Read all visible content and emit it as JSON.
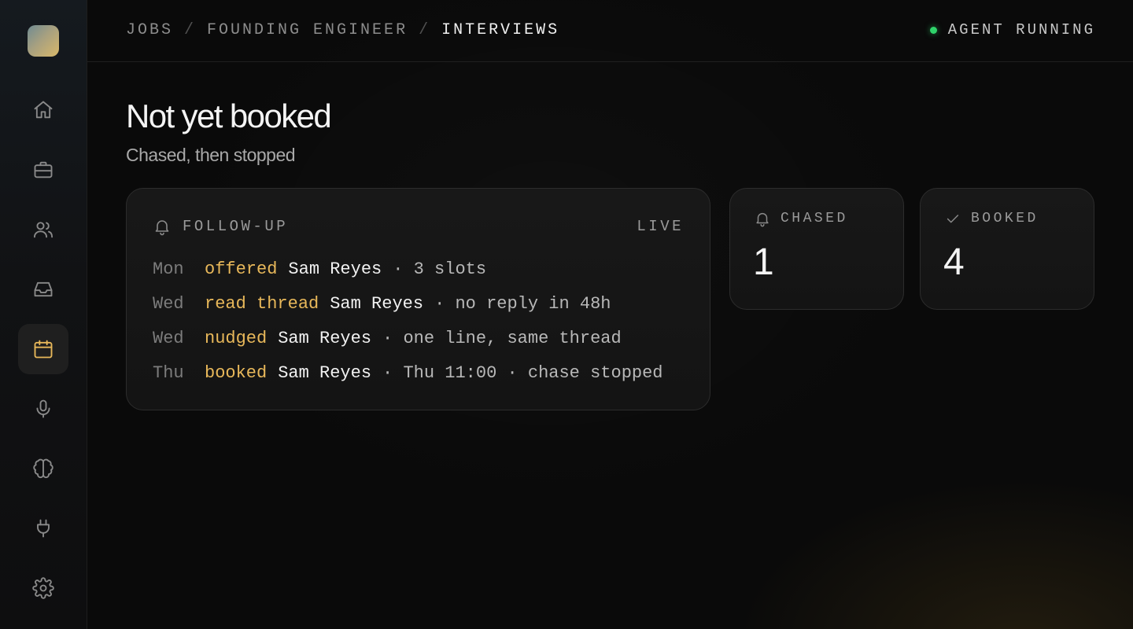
{
  "breadcrumb": {
    "items": [
      "JOBS",
      "FOUNDING ENGINEER",
      "INTERVIEWS"
    ],
    "separator": "/"
  },
  "status": {
    "label": "AGENT RUNNING",
    "color": "#2fd36a"
  },
  "sidebar": {
    "items": [
      {
        "icon": "home-icon",
        "active": false
      },
      {
        "icon": "briefcase-icon",
        "active": false
      },
      {
        "icon": "users-icon",
        "active": false
      },
      {
        "icon": "inbox-icon",
        "active": false
      },
      {
        "icon": "calendar-icon",
        "active": true
      },
      {
        "icon": "microphone-icon",
        "active": false
      },
      {
        "icon": "brain-icon",
        "active": false
      },
      {
        "icon": "plug-icon",
        "active": false
      },
      {
        "icon": "settings-icon",
        "active": false
      }
    ]
  },
  "page": {
    "title": "Not yet booked",
    "subtitle": "Chased, then stopped"
  },
  "followup": {
    "label": "FOLLOW-UP",
    "badge": "LIVE",
    "rows": [
      {
        "day": "Mon",
        "verb": "offered",
        "who": "Sam Reyes",
        "detail": "· 3 slots"
      },
      {
        "day": "Wed",
        "verb": "read thread",
        "who": "Sam Reyes",
        "detail": "· no reply in 48h"
      },
      {
        "day": "Wed",
        "verb": "nudged",
        "who": "Sam Reyes",
        "detail": "· one line, same thread"
      },
      {
        "day": "Thu",
        "verb": "booked",
        "who": "Sam Reyes",
        "detail": "· Thu 11:00 · chase stopped"
      }
    ]
  },
  "stats": {
    "chased": {
      "label": "CHASED",
      "value": "1",
      "icon": "bell-icon"
    },
    "booked": {
      "label": "BOOKED",
      "value": "4",
      "icon": "check-icon"
    }
  },
  "colors": {
    "accent": "#e8b85a",
    "background": "#0a0a0a"
  }
}
